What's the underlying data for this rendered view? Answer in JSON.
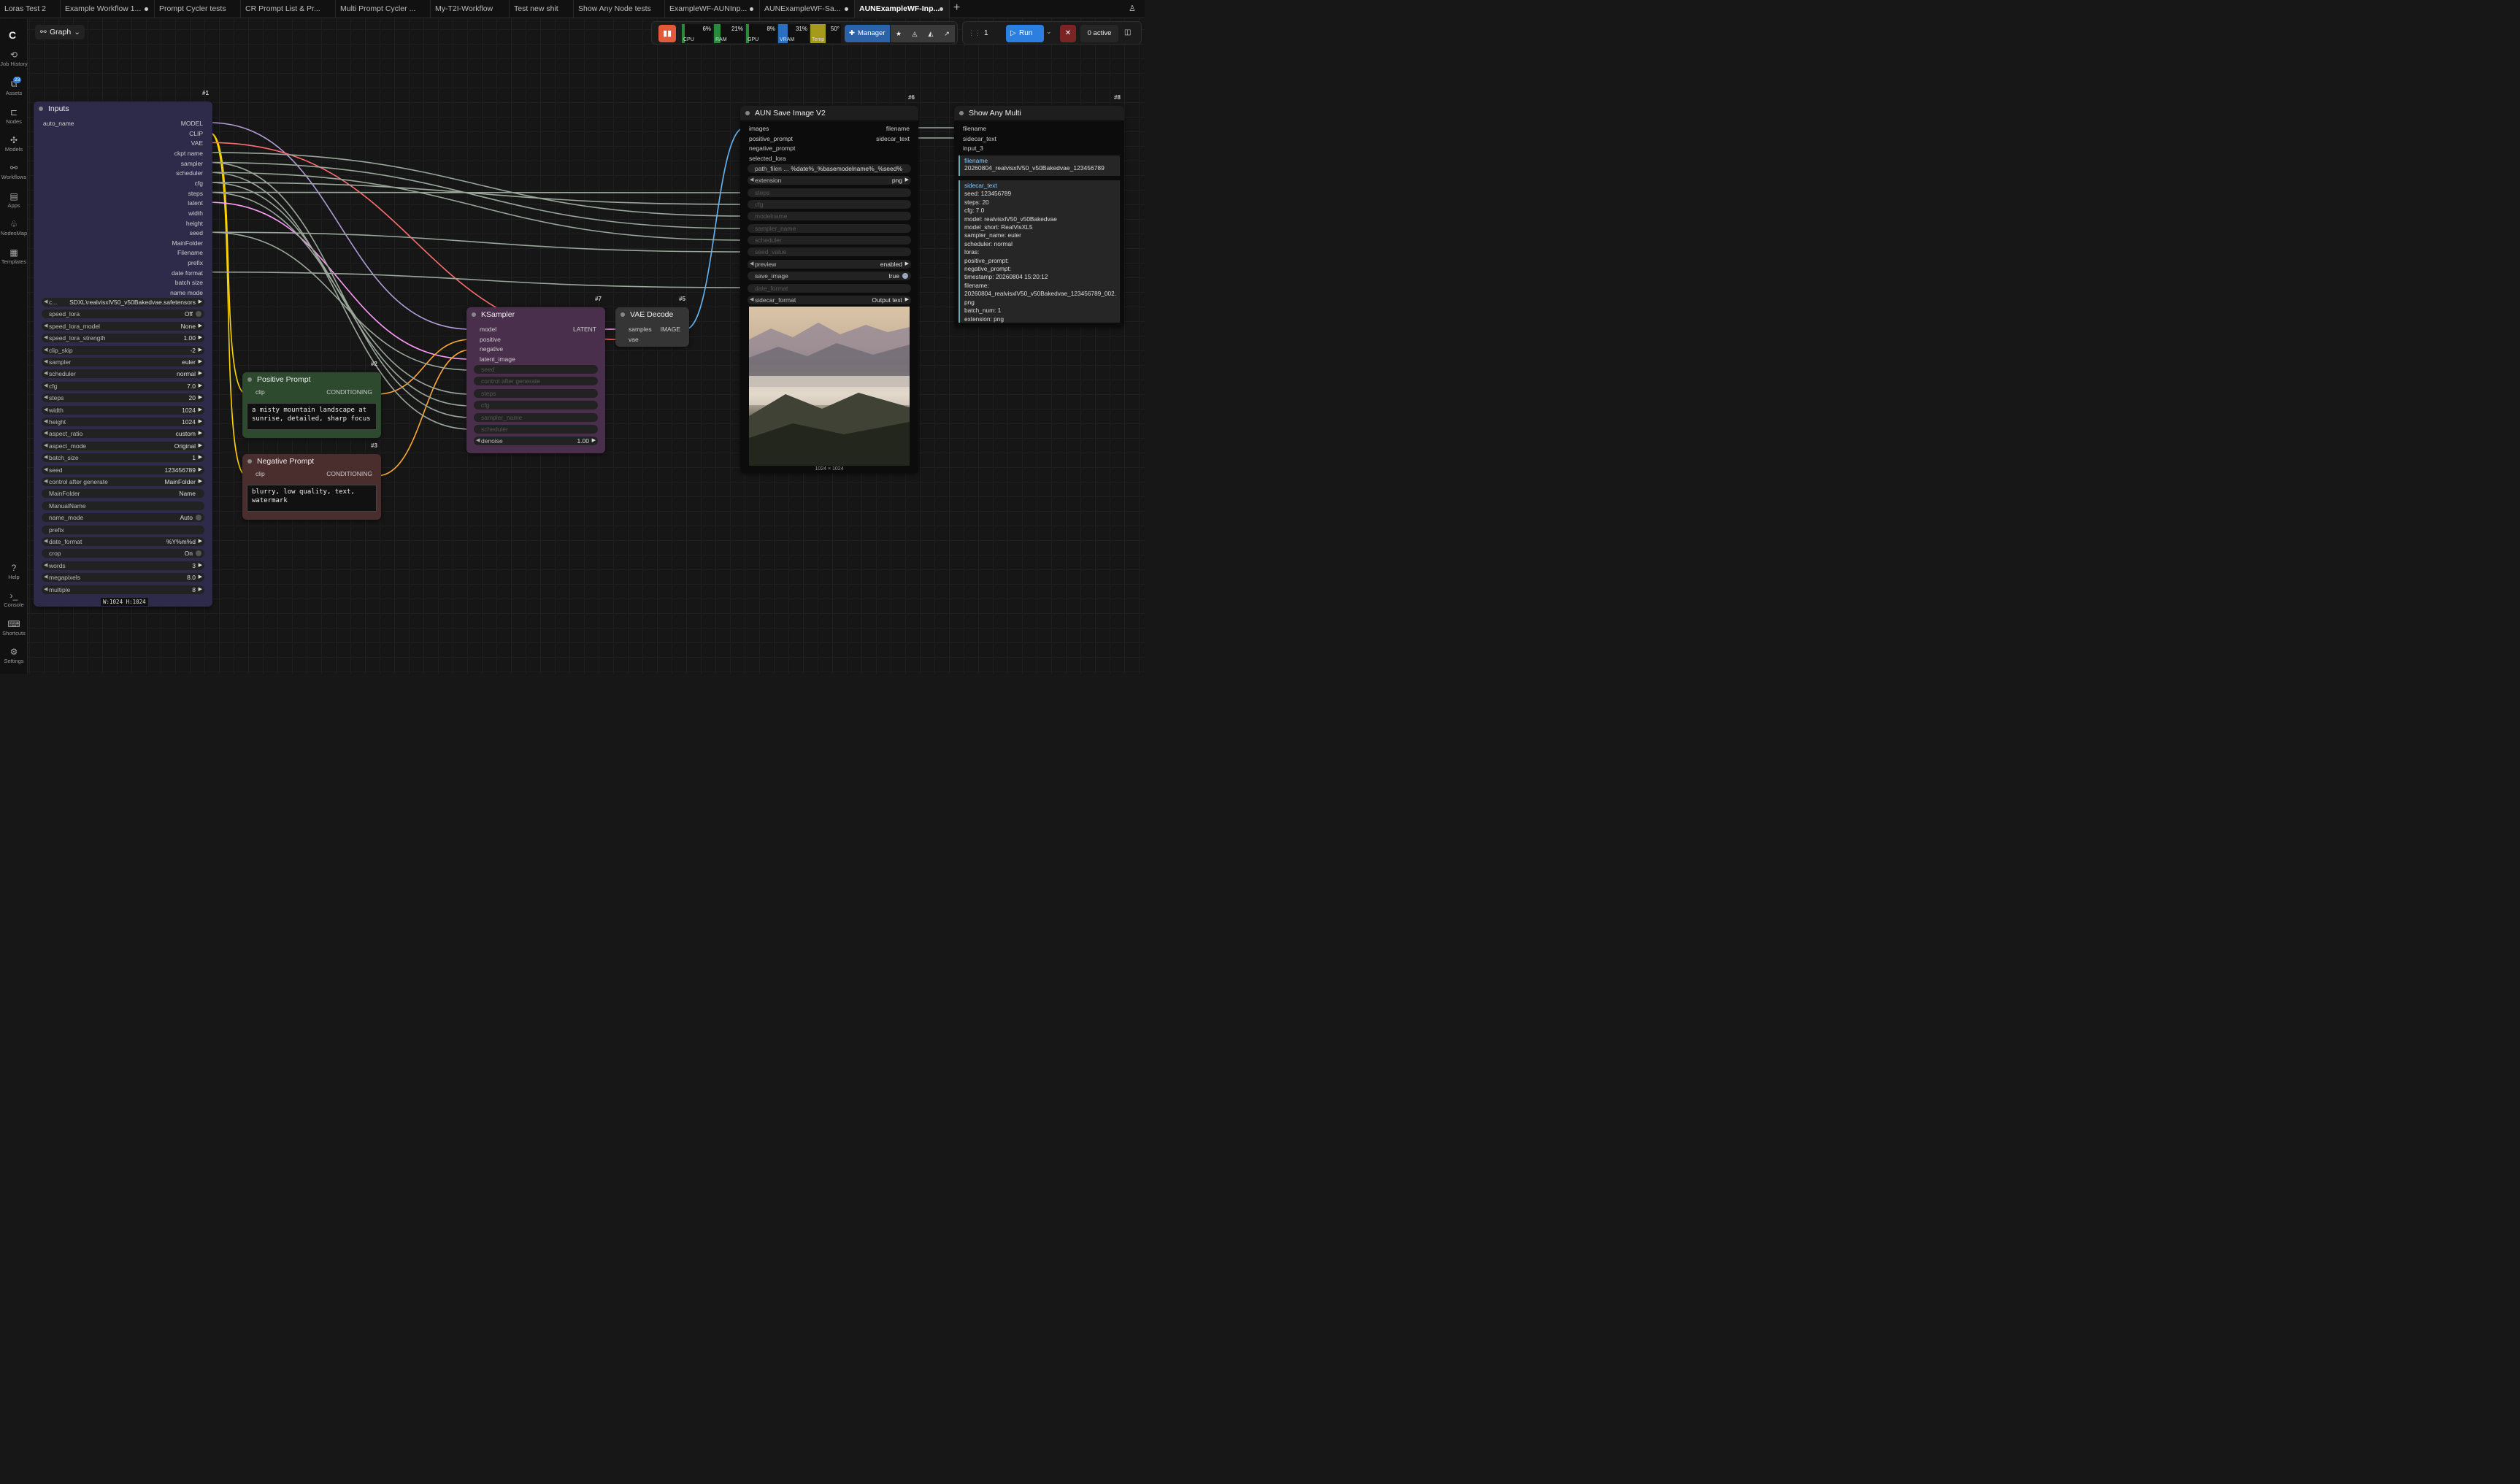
{
  "tabs": [
    "Loras Test 2",
    "Example Workflow 1...",
    "Prompt Cycler tests",
    "CR Prompt List & Pr...",
    "Multi Prompt Cycler ...",
    "My-T2I-Workflow",
    "Test new shit",
    "Show Any Node tests",
    "ExampleWF-AUNInp...",
    "AUNExampleWF-Sa...",
    "AUNExampleWF-Inp..."
  ],
  "tab_add": "+",
  "graph_label": "Graph",
  "sidebar": [
    {
      "label": "Job History",
      "icon": "⟲"
    },
    {
      "label": "Assets",
      "icon": "⧉",
      "badge": "23"
    },
    {
      "label": "Nodes",
      "icon": "⊏"
    },
    {
      "label": "Models",
      "icon": "✣"
    },
    {
      "label": "Workflows",
      "icon": "⚯"
    },
    {
      "label": "Apps",
      "icon": "▤"
    },
    {
      "label": "NodesMap",
      "icon": "♧"
    },
    {
      "label": "Templates",
      "icon": "▦"
    },
    {
      "label": "Help",
      "icon": "?"
    },
    {
      "label": "Console",
      "icon": "›_"
    },
    {
      "label": "Shortcuts",
      "icon": "⌨"
    },
    {
      "label": "Settings",
      "icon": "⚙"
    }
  ],
  "monitor": {
    "cpu": "6%",
    "ram": "21%",
    "gpu": "8%",
    "vram": "31%",
    "temp": "50°",
    "cpu_l": "CPU",
    "ram_l": "RAM",
    "gpu_l": "GPU",
    "vram_l": "VRAM",
    "temp_l": "Temp",
    "cpu_v": 0.06,
    "ram_v": 0.21,
    "gpu_v": 0.08,
    "vram_v": 0.31,
    "temp_v": 0.5
  },
  "toolbar": {
    "manager": "Manager",
    "queue_count": "1",
    "run": "Run",
    "active": "0 active"
  },
  "inputs_node": {
    "id": "#1",
    "title": "Inputs",
    "input": "auto_name",
    "outputs": [
      "MODEL",
      "CLIP",
      "VAE",
      "ckpt name",
      "sampler",
      "scheduler",
      "cfg",
      "steps",
      "latent",
      "width",
      "height",
      "seed",
      "MainFolder",
      "Filename",
      "prefix",
      "date format",
      "batch size",
      "name mode"
    ],
    "widgets": [
      {
        "l": "c...",
        "v": "SDXL\\realvisxlV50_v50Bakedvae.safetensors",
        "t": "combo"
      },
      {
        "l": "speed_lora",
        "v": "Off",
        "t": "toggle"
      },
      {
        "l": "speed_lora_model",
        "v": "None",
        "t": "combo"
      },
      {
        "l": "speed_lora_strength",
        "v": "1.00",
        "t": "combo"
      },
      {
        "l": "clip_skip",
        "v": "-2",
        "t": "combo"
      },
      {
        "l": "sampler",
        "v": "euler",
        "t": "combo"
      },
      {
        "l": "scheduler",
        "v": "normal",
        "t": "combo"
      },
      {
        "l": "cfg",
        "v": "7.0",
        "t": "combo"
      },
      {
        "l": "steps",
        "v": "20",
        "t": "combo"
      },
      {
        "l": "width",
        "v": "1024",
        "t": "combo"
      },
      {
        "l": "height",
        "v": "1024",
        "t": "combo"
      },
      {
        "l": "aspect_ratio",
        "v": "custom",
        "t": "combo"
      },
      {
        "l": "aspect_mode",
        "v": "Original",
        "t": "combo"
      },
      {
        "l": "batch_size",
        "v": "1",
        "t": "combo"
      },
      {
        "l": "seed",
        "v": "123456789",
        "t": "combo"
      },
      {
        "l": "control after generate",
        "v": "MainFolder",
        "t": "combo"
      },
      {
        "l": "MainFolder",
        "v": "Name",
        "t": "text"
      },
      {
        "l": "ManualName",
        "v": "",
        "t": "text"
      },
      {
        "l": "name_mode",
        "v": "Auto",
        "t": "toggle"
      },
      {
        "l": "prefix",
        "v": "",
        "t": "text"
      },
      {
        "l": "date_format",
        "v": "%Y%m%d",
        "t": "combo"
      },
      {
        "l": "crop",
        "v": "On",
        "t": "toggle"
      },
      {
        "l": "words",
        "v": "3",
        "t": "combo"
      },
      {
        "l": "megapixels",
        "v": "8.0",
        "t": "combo"
      },
      {
        "l": "multiple",
        "v": "8",
        "t": "combo"
      }
    ],
    "size_label": "W:1024 H:1024"
  },
  "pos_node": {
    "id": "#2",
    "title": "Positive Prompt",
    "in": "clip",
    "out": "CONDITIONING",
    "text": "a misty mountain landscape at\nsunrise, detailed, sharp focus"
  },
  "neg_node": {
    "id": "#3",
    "title": "Negative Prompt",
    "in": "clip",
    "out": "CONDITIONING",
    "text": "blurry, low quality, text,\nwatermark"
  },
  "ksampler": {
    "id": "#7",
    "title": "KSampler",
    "inputs": [
      "model",
      "positive",
      "negative",
      "latent_image"
    ],
    "out": "LATENT",
    "widgets": [
      "seed",
      "control after generate",
      "steps",
      "cfg",
      "sampler_name",
      "scheduler"
    ],
    "denoise_l": "denoise",
    "denoise_v": "1.00"
  },
  "vae_node": {
    "id": "#5",
    "title": "VAE Decode",
    "inputs": [
      "samples",
      "vae"
    ],
    "out": "IMAGE"
  },
  "save_node": {
    "id": "#6",
    "title": "AUN Save Image V2",
    "inputs": [
      "images",
      "positive_prompt",
      "negative_prompt",
      "selected_lora"
    ],
    "outputs": [
      "filename",
      "sidecar_text"
    ],
    "widgets": [
      {
        "l": "path_filen ...",
        "v": "%date%_%basemodelname%_%seed%",
        "t": "text"
      },
      {
        "l": "extension",
        "v": "png",
        "t": "combo"
      },
      {
        "l": "steps",
        "v": "",
        "t": "dim"
      },
      {
        "l": "cfg",
        "v": "",
        "t": "dim"
      },
      {
        "l": "modelname",
        "v": "",
        "t": "dim"
      },
      {
        "l": "sampler_name",
        "v": "",
        "t": "dim"
      },
      {
        "l": "scheduler",
        "v": "",
        "t": "dim"
      },
      {
        "l": "seed_value",
        "v": "",
        "t": "dim"
      },
      {
        "l": "preview",
        "v": "enabled",
        "t": "combo"
      },
      {
        "l": "save_image",
        "v": "true",
        "t": "toggle"
      },
      {
        "l": "date_format",
        "v": "",
        "t": "dim"
      },
      {
        "l": "sidecar_format",
        "v": "Output text",
        "t": "combo"
      }
    ],
    "image_size": "1024 × 1024"
  },
  "show_node": {
    "id": "#8",
    "title": "Show Any Multi",
    "inputs": [
      "filename",
      "sidecar_text",
      "input_3"
    ],
    "box1_title": "filename",
    "box1_text": "20260804_realvisxlV50_v50Bakedvae_123456789",
    "box2_title": "sidecar_text",
    "lines": [
      "seed: 123456789",
      "steps: 20",
      "cfg: 7.0",
      "model: realvisxlV50_v50Bakedvae",
      "model_short: RealVisXL5",
      "sampler_name: euler",
      "scheduler: normal",
      "loras:",
      "positive_prompt:",
      "negative_prompt:",
      "timestamp: 20260804 15:20:12",
      "filename:",
      "20260804_realvisxlV50_v50Bakedvae_123456789_002.",
      "png",
      "batch_num: 1",
      "extension: png"
    ]
  },
  "colors": {
    "model": "#b39ddb",
    "clip": "#ffd500",
    "vae": "#ff6e6e",
    "latent": "#ff9cf9",
    "image": "#64b5f6",
    "cond": "#ffa931",
    "widget": "#9aa79a",
    "string": "#7fe07f"
  }
}
